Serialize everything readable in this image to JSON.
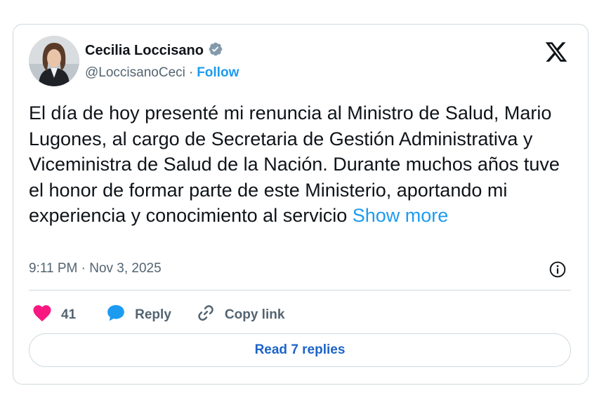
{
  "author": {
    "name": "Cecilia Loccisano",
    "handle": "@LoccisanoCeci",
    "separator": "·",
    "follow_label": "Follow"
  },
  "tweet": {
    "text": "El día de hoy presenté mi renuncia al Ministro de Salud, Mario Lugones, al cargo de Secretaria de Gestión Administrativa y Viceministra de Salud de la Nación. Durante muchos años tuve el honor de formar parte de este Ministerio, aportando mi experiencia y conocimiento al servicio",
    "show_more_label": "Show more",
    "timestamp": "9:11 PM · Nov 3, 2025"
  },
  "actions": {
    "like_count": "41",
    "reply_label": "Reply",
    "copy_link_label": "Copy link"
  },
  "read_replies_label": "Read 7 replies",
  "colors": {
    "accent": "#1d9bf0",
    "like": "#f91880",
    "reply_icon": "#1d9bf0",
    "text": "#0f1419",
    "muted": "#536471",
    "border": "#cfd9de",
    "button_text": "#1d64c8"
  },
  "icons": {
    "verified": "verified-badge-icon",
    "logo": "x-logo-icon",
    "info": "info-icon",
    "like": "heart-icon",
    "reply": "speech-bubble-icon",
    "copy_link": "link-icon"
  }
}
